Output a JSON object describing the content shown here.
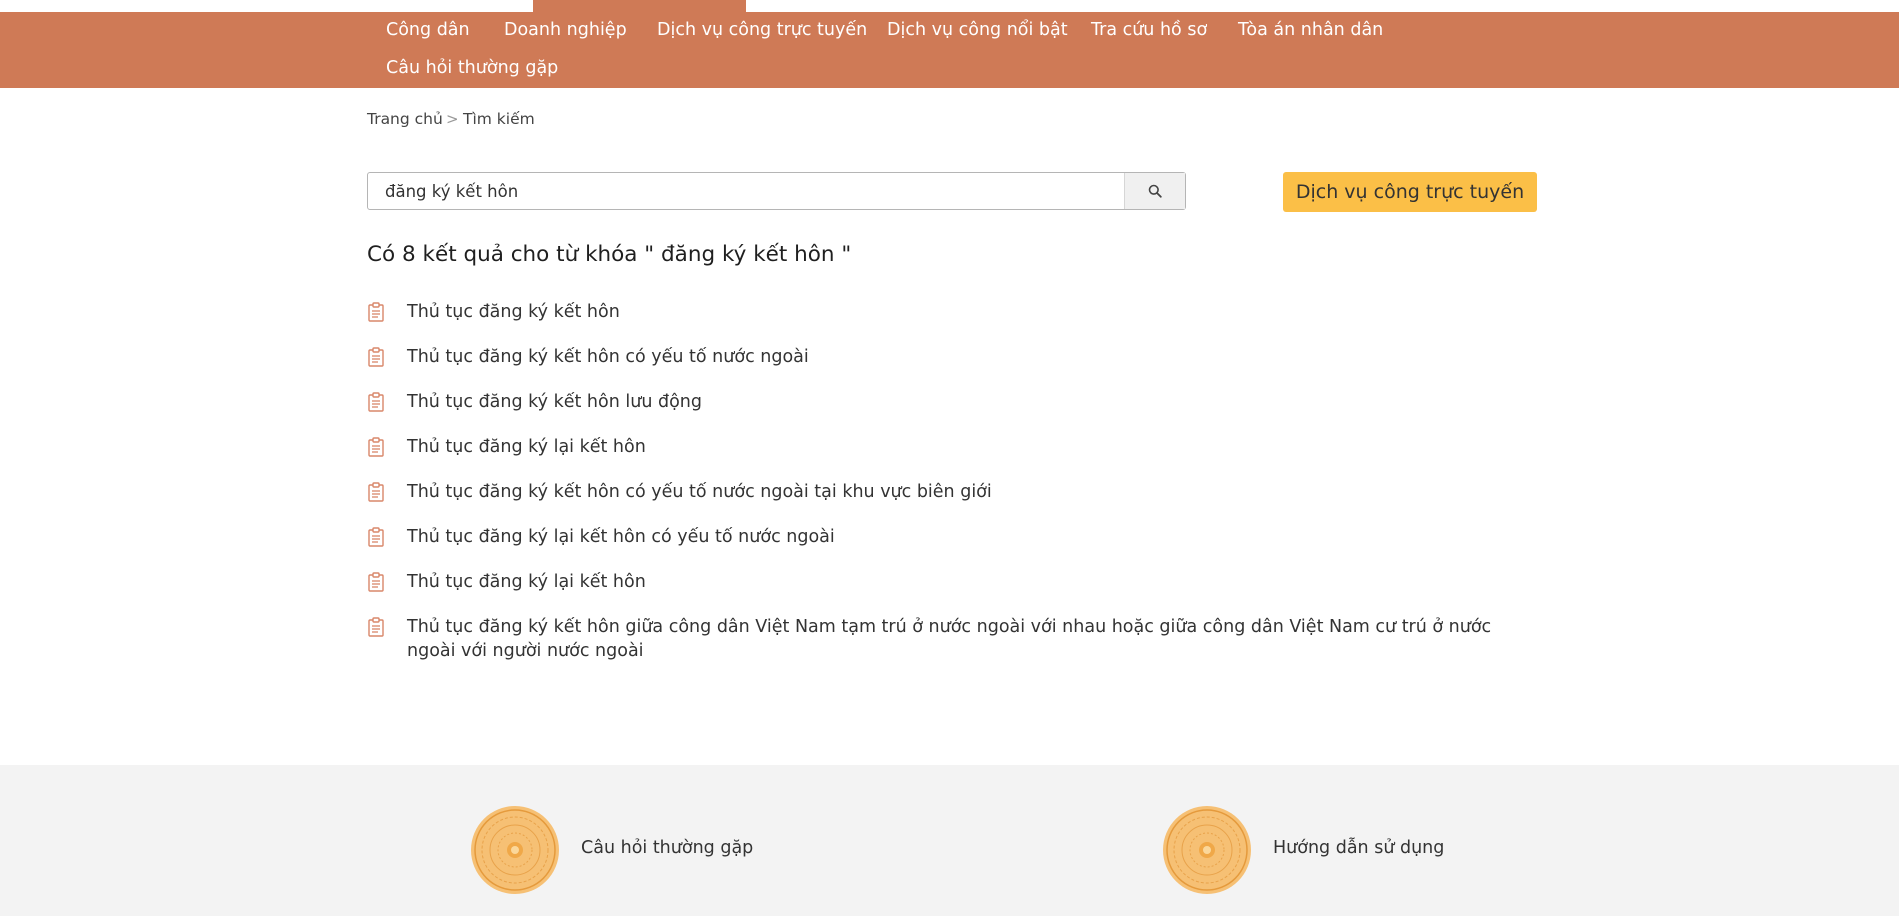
{
  "nav": {
    "items": [
      "Công dân",
      "Doanh nghiệp",
      "Dịch vụ công trực tuyến",
      "Dịch vụ công nổi bật",
      "Tra cứu hồ sơ",
      "Tòa án nhân dân",
      "Câu hỏi thường gặp"
    ]
  },
  "breadcrumb": {
    "home": "Trang chủ",
    "separator": ">",
    "current": "Tìm kiếm"
  },
  "search": {
    "value": "đăng ký kết hôn",
    "icon": "search-icon"
  },
  "online_service_button": "Dịch vụ công trực tuyến",
  "results": {
    "heading": "Có 8 kết quả cho từ khóa \" đăng ký kết hôn \"",
    "items": [
      "Thủ tục đăng ký kết hôn",
      "Thủ tục đăng ký kết hôn có yếu tố nước ngoài",
      "Thủ tục đăng ký kết hôn lưu động",
      "Thủ tục đăng ký lại kết hôn",
      "Thủ tục đăng ký kết hôn có yếu tố nước ngoài tại khu vực biên giới",
      "Thủ tục đăng ký lại kết hôn có yếu tố nước ngoài",
      "Thủ tục đăng ký lại kết hôn",
      "Thủ tục đăng ký kết hôn giữa công dân Việt Nam tạm trú ở nước ngoài với nhau hoặc giữa công dân Việt Nam cư trú ở nước ngoài với người nước ngoài"
    ]
  },
  "footer": {
    "faq": "Câu hỏi thường gặp",
    "guide": "Hướng dẫn sử dụng"
  },
  "colors": {
    "nav_bg": "#cf7a56",
    "button_bg": "#fbbf47",
    "footer_bg": "#f3f3f3",
    "icon": "#d9876a"
  }
}
